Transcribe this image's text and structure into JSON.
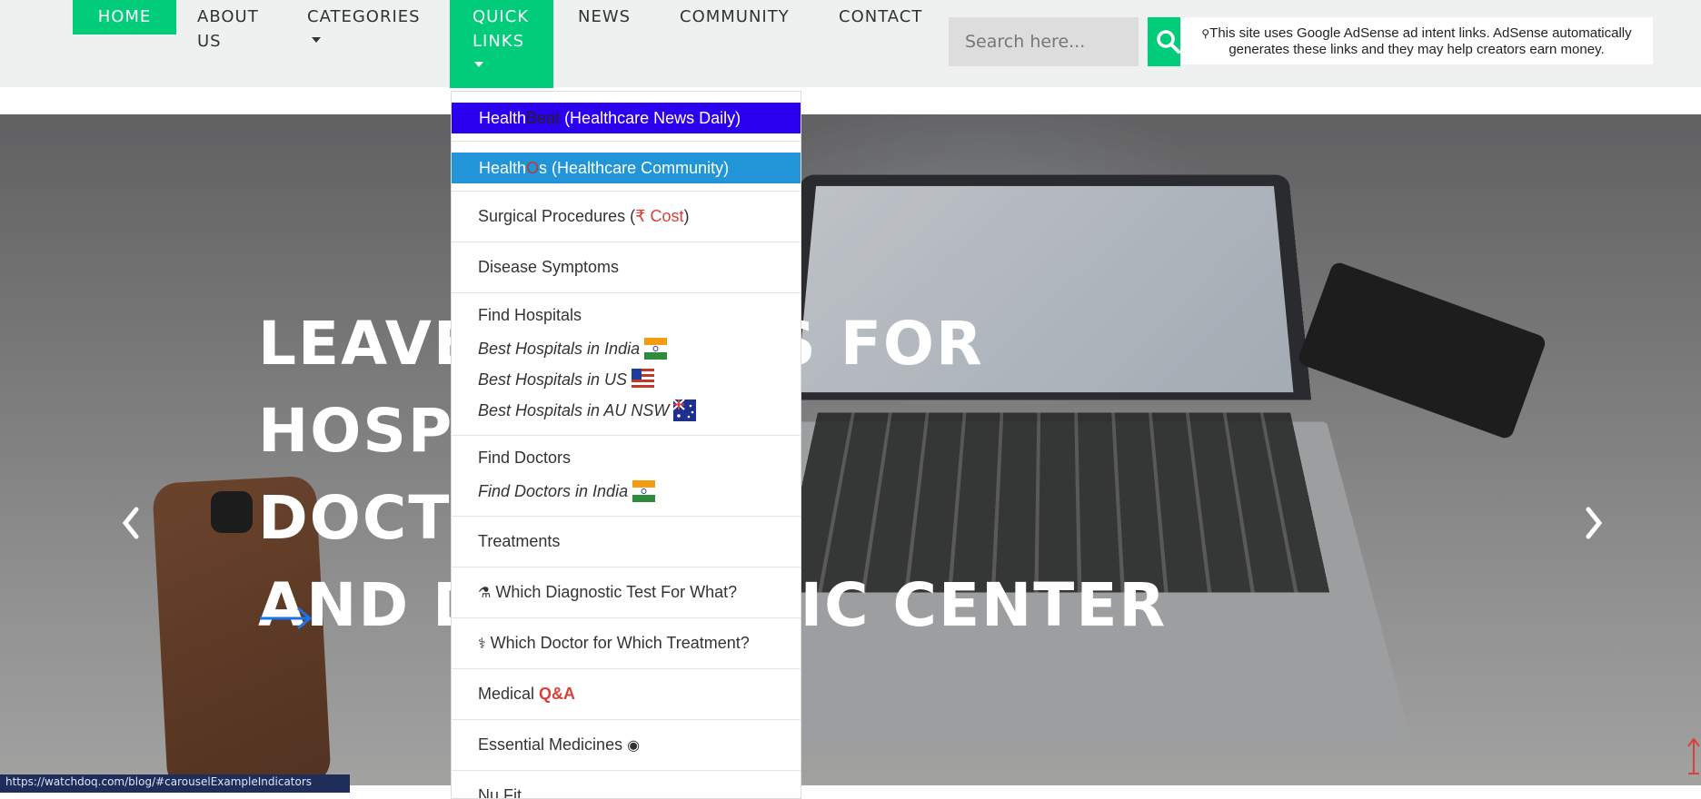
{
  "nav": {
    "items": [
      {
        "label": "HOME",
        "active": true
      },
      {
        "label": "ABOUT US"
      },
      {
        "label": "CATEGORIES",
        "has_caret": true
      },
      {
        "label": "QUICK LINKS",
        "active": true,
        "has_caret": true
      },
      {
        "label": "NEWS"
      },
      {
        "label": "COMMUNITY"
      },
      {
        "label": "CONTACT"
      }
    ],
    "about_line1": "ABOUT",
    "about_line2": "US",
    "quick_line1": "QUICK",
    "quick_line2": "LINKS",
    "accent_color": "#00cc7a"
  },
  "search": {
    "placeholder": "Search here...",
    "button_icon": "search-icon"
  },
  "adsense": {
    "icon": "magnifier-icon",
    "line1": "This site uses Google AdSense ad intent links. AdSense automatically",
    "line2": "generates these links and they may help creators earn money."
  },
  "dropdown": {
    "healthbeat": {
      "part1": "Health",
      "part2": "Beat",
      "part3": " (Healthcare News Daily)",
      "bg": "#2a00ee"
    },
    "healthos": {
      "part1": "Health",
      "part2": "O",
      "part3": "s (Healthcare Community)",
      "bg": "#2294d8"
    },
    "surgical": {
      "text": "Surgical Procedures (",
      "cost": "₹ Cost",
      "close": ")"
    },
    "symptoms": "Disease Symptoms",
    "find_hospitals": "Find Hospitals",
    "hospitals_india": "Best Hospitals in India",
    "hospitals_us": "Best Hospitals in US",
    "hospitals_au": "Best Hospitals in AU NSW",
    "find_doctors": "Find Doctors",
    "doctors_india": "Find Doctors in India",
    "treatments": "Treatments",
    "diagnostic": "Which Diagnostic Test For What?",
    "which_doctor": "Which Doctor for Which Treatment?",
    "medical": "Medical ",
    "qa": "Q&A",
    "essential": "Essential Medicines",
    "partial": "Nu Fit"
  },
  "hero": {
    "line1": "LEAVE REVIEWS FOR HOSPITALS,",
    "line2": "DOCTORS",
    "line3": "AND DIAGNOSTIC CENTER",
    "arrow_color": "#1a73e8"
  },
  "status_url": "https://watchdoq.com/blog/#carouselExampleIndicators"
}
